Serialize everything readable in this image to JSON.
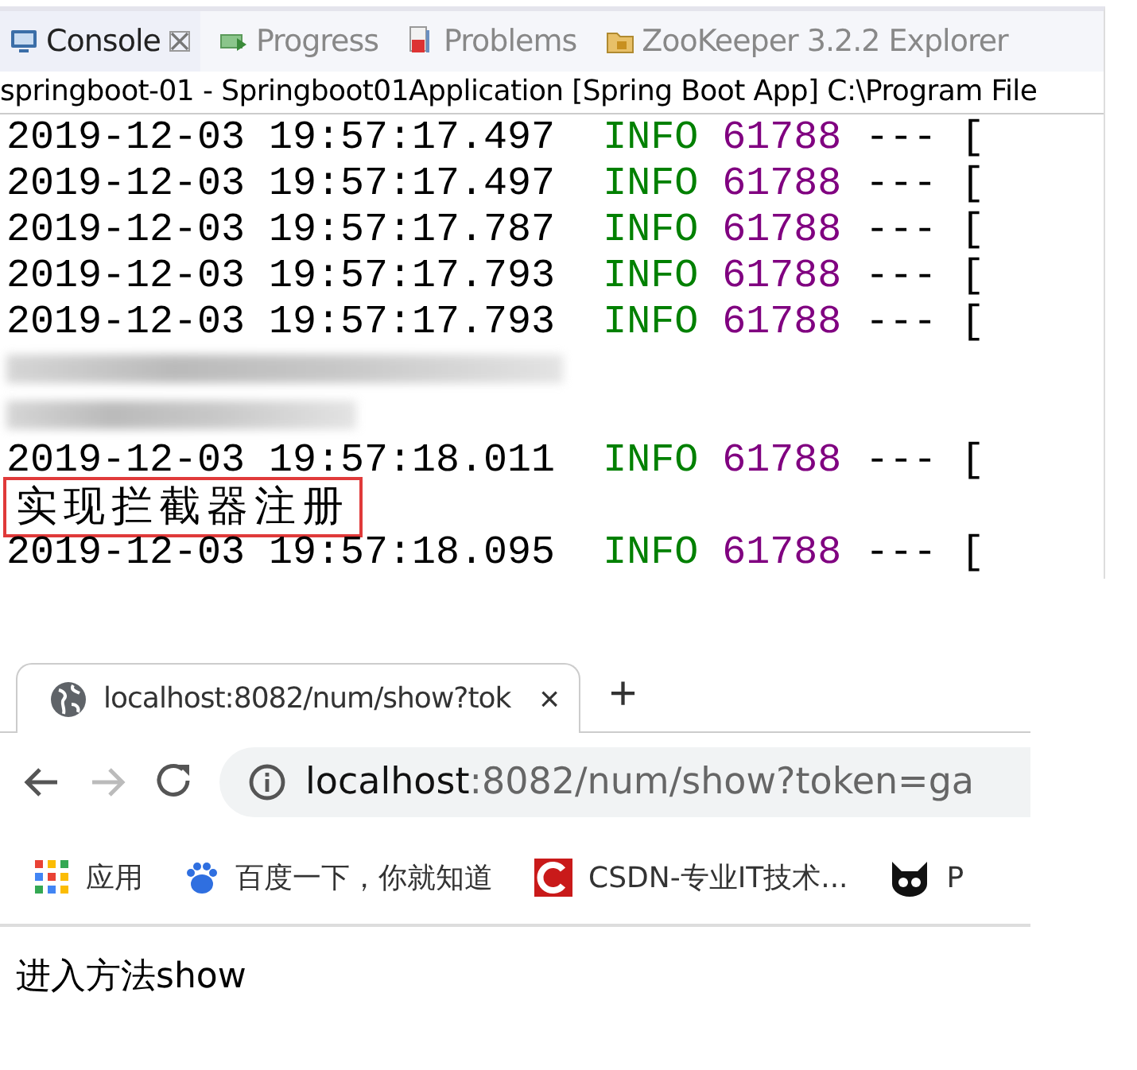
{
  "console": {
    "tabs": [
      {
        "label": "Console",
        "selected": true
      },
      {
        "label": "Progress",
        "selected": false
      },
      {
        "label": "Problems",
        "selected": false
      },
      {
        "label": "ZooKeeper 3.2.2 Explorer",
        "selected": false
      }
    ],
    "launch": "springboot-01 - Springboot01Application [Spring Boot App] C:\\Program File",
    "lines": [
      {
        "kind": "log",
        "timestamp": "2019-12-03 19:57:17.497",
        "level": "INFO",
        "pid": "61788",
        "sep": "---",
        "thread": "["
      },
      {
        "kind": "log",
        "timestamp": "2019-12-03 19:57:17.497",
        "level": "INFO",
        "pid": "61788",
        "sep": "---",
        "thread": "["
      },
      {
        "kind": "log",
        "timestamp": "2019-12-03 19:57:17.787",
        "level": "INFO",
        "pid": "61788",
        "sep": "---",
        "thread": "["
      },
      {
        "kind": "log",
        "timestamp": "2019-12-03 19:57:17.793",
        "level": "INFO",
        "pid": "61788",
        "sep": "---",
        "thread": "["
      },
      {
        "kind": "log",
        "timestamp": "2019-12-03 19:57:17.793",
        "level": "INFO",
        "pid": "61788",
        "sep": "---",
        "thread": "["
      },
      {
        "kind": "redacted"
      },
      {
        "kind": "redacted"
      },
      {
        "kind": "log",
        "timestamp": "2019-12-03 19:57:18.011",
        "level": "INFO",
        "pid": "61788",
        "sep": "---",
        "thread": "["
      },
      {
        "kind": "highlight",
        "text": "实现拦截器注册"
      },
      {
        "kind": "log",
        "timestamp": "2019-12-03 19:57:18.095",
        "level": "INFO",
        "pid": "61788",
        "sep": "---",
        "thread": "["
      }
    ]
  },
  "browser": {
    "tab": {
      "title": "localhost:8082/num/show?tok",
      "close": "×"
    },
    "new_tab": "+",
    "address": {
      "host": "localhost",
      "rest": ":8082/num/show?token=ga"
    },
    "bookmarks": [
      {
        "label": "应用"
      },
      {
        "label": "百度一下，你就知道"
      },
      {
        "label": "CSDN-专业IT技术..."
      },
      {
        "label": "P"
      }
    ],
    "content": "进入方法show"
  }
}
